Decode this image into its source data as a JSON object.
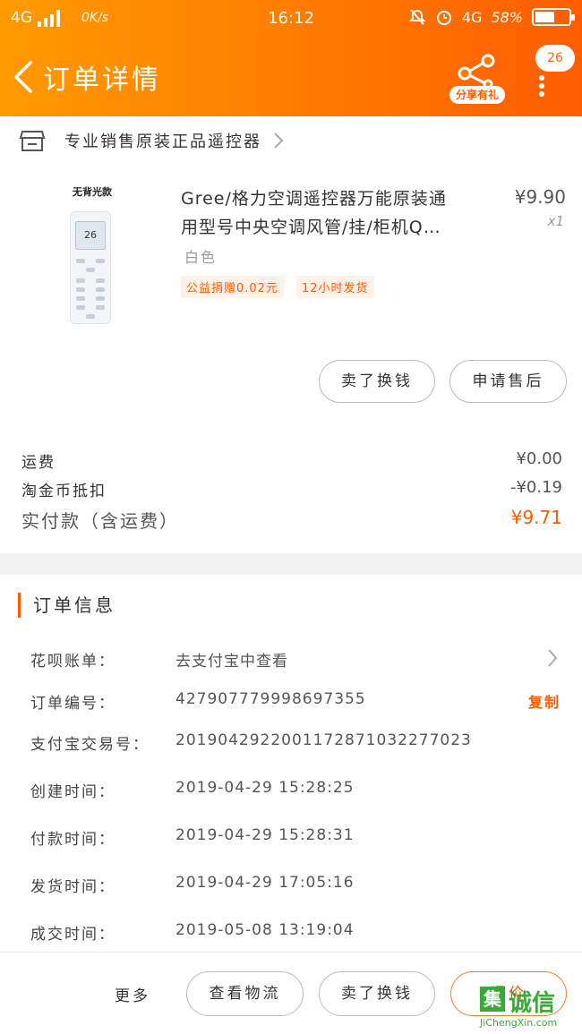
{
  "status_bar": {
    "network": "4G",
    "speed": "0K/s",
    "time": "16:12",
    "network_right": "4G",
    "battery": "58%",
    "battery_level": 0.58
  },
  "header": {
    "title": "订单详情",
    "share_label": "分享有礼",
    "message_count": "26"
  },
  "shop": {
    "name": "专业销售原装正品遥控器"
  },
  "product": {
    "image_caption": "无背光款",
    "image_screen_text": "26",
    "title_line1": "Gree/格力空调遥控器万能原装通",
    "title_line2": "用型号中央空调风管/挂/柜机Q…",
    "price": "¥9.90",
    "quantity": "x1",
    "sku": "白色",
    "tags": [
      "公益捐赠0.02元",
      "12小时发货"
    ],
    "buttons": [
      "卖了换钱",
      "申请售后"
    ]
  },
  "fees": [
    {
      "label": "运费",
      "value": "¥0.00"
    },
    {
      "label": "淘金币抵扣",
      "value": "-¥0.19"
    },
    {
      "label": "实付款（含运费）",
      "value": "¥9.71"
    }
  ],
  "order_info": {
    "title": "订单信息",
    "rows": [
      {
        "label": "花呗账单：",
        "value": "去支付宝中查看"
      },
      {
        "label": "订单编号：",
        "value": "427907779998697355",
        "action": "复制"
      },
      {
        "label": "支付宝交易号：",
        "value": "2019042922001172871032277023"
      },
      {
        "label": "创建时间：",
        "value": "2019-04-29  15:28:25"
      },
      {
        "label": "付款时间：",
        "value": "2019-04-29  15:28:31"
      },
      {
        "label": "发货时间：",
        "value": "2019-04-29  17:05:16"
      },
      {
        "label": "成交时间：",
        "value": "2019-05-08  13:19:04"
      }
    ]
  },
  "bottom_bar": {
    "more": "更多",
    "buttons": [
      "查看物流",
      "卖了换钱",
      "评价"
    ]
  },
  "watermark": {
    "glyph": "集",
    "text": "诚信",
    "url": "JiChengXin.com"
  },
  "colors": {
    "accent": "#ff5a00",
    "header_start": "#ff9a00",
    "header_end": "#ff5c00"
  }
}
